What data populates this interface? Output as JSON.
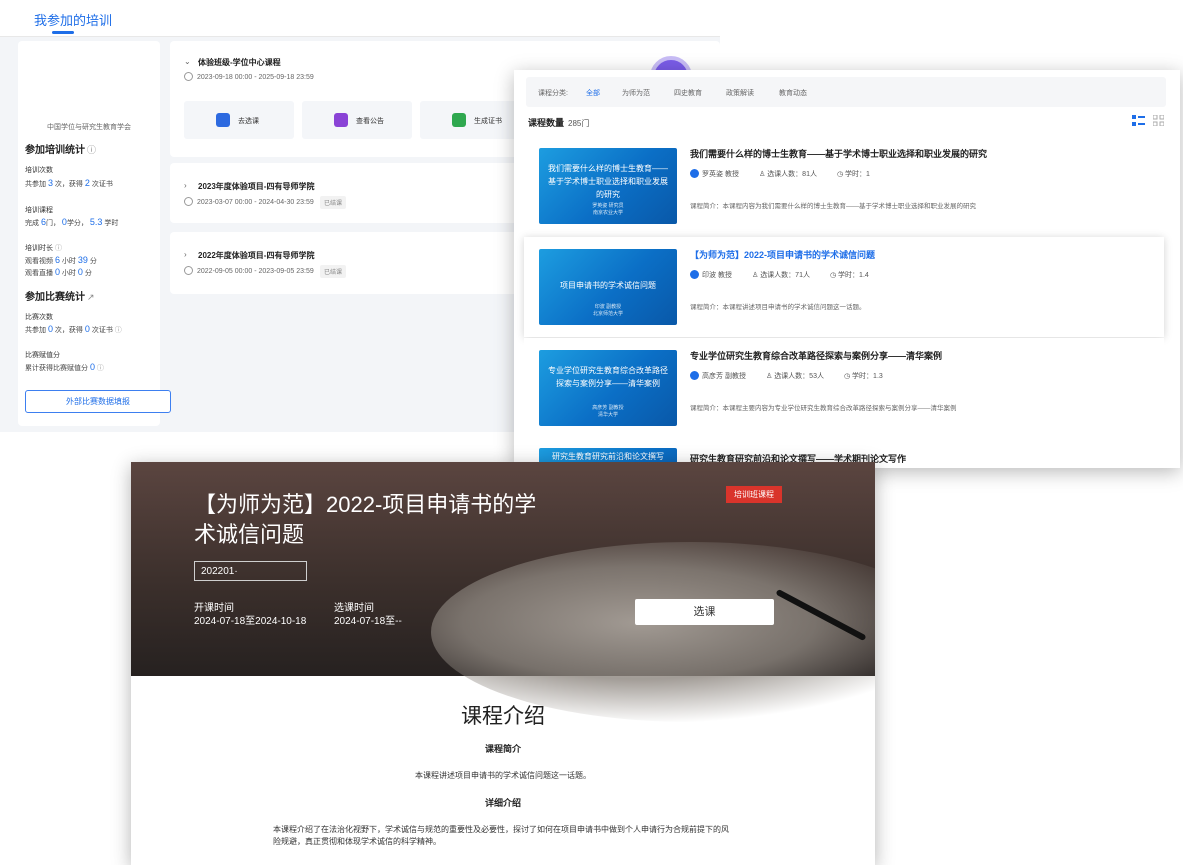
{
  "panel_a": {
    "tab": "我参加的培训",
    "org_name": "中国学位与研究生教育学会",
    "stats_heading": "参加培训统计",
    "training_count_label": "培训次数",
    "training_count": {
      "p1": "共参加 ",
      "n1": "3",
      "p2": " 次，获得 ",
      "n2": "2",
      "p3": " 次证书"
    },
    "course_label": "培训课程",
    "course": {
      "p1": "完成 ",
      "n1": "6",
      "p2": "门， ",
      "n2": "0",
      "p3": "学分， ",
      "n3": "5.3",
      "p4": " 学时"
    },
    "duration_label": "培训时长",
    "video": {
      "p1": "观看视频 ",
      "n1": "6",
      "p2": " 小时 ",
      "n2": "39",
      "p3": " 分"
    },
    "live": {
      "p1": "观看直播 ",
      "n1": "0",
      "p2": " 小时 ",
      "n2": "0",
      "p3": " 分"
    },
    "contest_heading": "参加比赛统计",
    "contest_count_label": "比赛次数",
    "contest_count": {
      "p1": "共参加 ",
      "n1": "0",
      "p2": " 次，获得 ",
      "n2": "0",
      "p3": " 次证书"
    },
    "contest_score_label": "比赛赋值分",
    "contest_score": {
      "p1": "累计获得比赛赋值分 ",
      "n1": "0"
    },
    "external_button": "外部比赛数据填报",
    "projects": [
      {
        "title": "体验班级-学位中心课程",
        "time": "2023-09-18 00:00 - 2025-09-18 23:59"
      },
      {
        "title": "2023年度体验项目-四有导师学院",
        "time": "2023-03-07 00:00 - 2024-04-30 23:59",
        "badge": "已结课"
      },
      {
        "title": "2022年度体验项目-四有导师学院",
        "time": "2022-09-05 00:00 - 2023-09-05 23:59",
        "badge": "已结课"
      }
    ],
    "actions": [
      "去选课",
      "查看公告",
      "生成证书"
    ]
  },
  "panel_b": {
    "cat_label": "课程分类:",
    "categories": [
      "全部",
      "为师为范",
      "四史教育",
      "政策解读",
      "教育动态"
    ],
    "count_label": "课程数量",
    "count": "285门",
    "courses": [
      {
        "thumb_title": "我们需要什么样的博士生教育——基于学术博士职业选择和职业发展的研究",
        "thumb_sub": "罗英姿 研究员\n南京农业大学",
        "title": "我们需要什么样的博士生教育——基于学术博士职业选择和职业发展的研究",
        "teacher": "罗英姿 教授",
        "students": "选课人数：81人",
        "hours": "学时：1",
        "desc": "课程简介：本课程内容为我们需要什么样的博士生教育——基于学术博士职业选择和职业发展的研究"
      },
      {
        "thumb_title": "项目申请书的学术诚信问题",
        "thumb_sub": "印波 副教授\n北京师范大学",
        "title": "【为师为范】2022-项目申请书的学术诚信问题",
        "teacher": "印波 教授",
        "students": "选课人数：71人",
        "hours": "学时：1.4",
        "desc": "课程简介：本课程讲述项目申请书的学术诚信问题这一话题。"
      },
      {
        "thumb_title": "专业学位研究生教育综合改革路径探索与案例分享——清华案例",
        "thumb_sub": "高彦芳 副教授\n清华大学",
        "title": "专业学位研究生教育综合改革路径探索与案例分享——清华案例",
        "teacher": "高彦芳 副教授",
        "students": "选课人数：53人",
        "hours": "学时：1.3",
        "desc": "课程简介：本课程主要内容为专业学位研究生教育综合改革路径探索与案例分享——清华案例"
      },
      {
        "thumb_title": "研究生教育研究前沿和论文撰写",
        "thumb_sub": "",
        "title": "研究生教育研究前沿和论文撰写——学术期刊论文写作",
        "teacher": "",
        "students": "",
        "hours": "",
        "desc": ""
      }
    ]
  },
  "panel_c": {
    "title": "【为师为范】2022-项目申请书的学术诚信问题",
    "ribbon": "培训班课程",
    "input_value": "202201·",
    "start_label": "开课时间",
    "start_value": "2024-07-18至2024-10-18",
    "select_label": "选课时间",
    "select_value": "2024-07-18至--",
    "select_button": "选课",
    "section_heading": "课程介绍",
    "brief_heading": "课程简介",
    "brief_text": "本课程讲述项目申请书的学术诚信问题这一话题。",
    "detail_heading": "详细介绍",
    "detail_text": "本课程介绍了在法治化视野下，学术诚信与规范的重要性及必要性，探讨了如何在项目申请书中做到个人申请行为合规前提下的风险规避，真正贯彻和体现学术诚信的科学精神。"
  },
  "colors": {
    "accent": "#1e6ee8",
    "ribbon": "#d9342b",
    "thumb": "#0b6fc6"
  }
}
